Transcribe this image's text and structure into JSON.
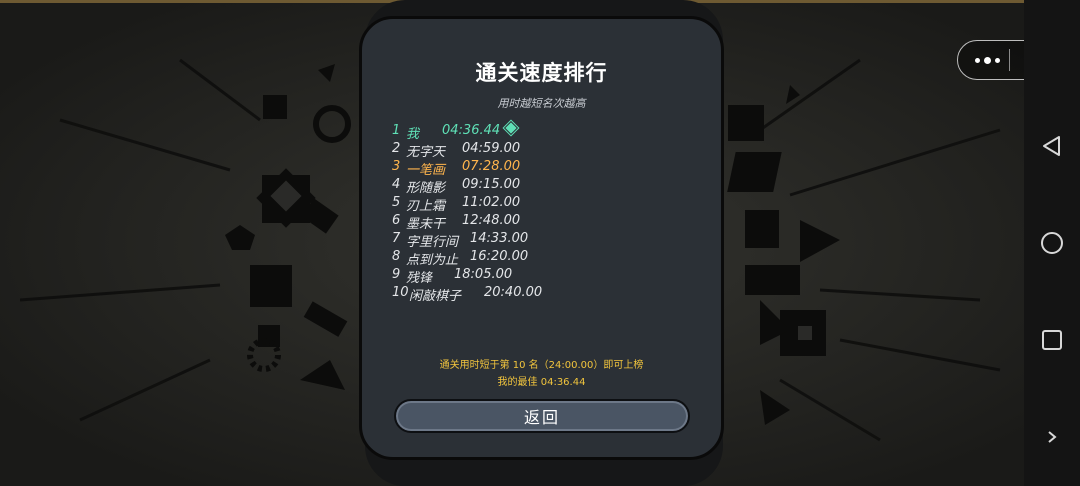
{
  "dialog": {
    "title": "通关速度排行",
    "subtitle": "用时越短名次越高",
    "rankings": [
      {
        "rank": "1",
        "name": "我",
        "time": "04:36.44",
        "highlight": "self"
      },
      {
        "rank": "2",
        "name": "无字天",
        "time": "04:59.00"
      },
      {
        "rank": "3",
        "name": "一笔画",
        "time": "07:28.00",
        "highlight": "gold"
      },
      {
        "rank": "4",
        "name": "形随影",
        "time": "09:15.00"
      },
      {
        "rank": "5",
        "name": "刃上霜",
        "time": "11:02.00"
      },
      {
        "rank": "6",
        "name": "墨未干",
        "time": "12:48.00"
      },
      {
        "rank": "7",
        "name": "字里行间",
        "time": "14:33.00"
      },
      {
        "rank": "8",
        "name": "点到为止",
        "time": "16:20.00"
      },
      {
        "rank": "9",
        "name": "残锋",
        "time": "18:05.00"
      },
      {
        "rank": "10",
        "name": "闲敲棋子",
        "time": "20:40.00"
      }
    ],
    "note": "通关用时短于第 10 名（24:00.00）即可上榜",
    "best": "我的最佳  04:36.44",
    "back_label": "返回"
  },
  "colors": {
    "self": "#5fe0b6",
    "gold": "#ffb54d",
    "note": "#f2c53d",
    "panel": "#2b3036"
  },
  "icons": {
    "capsule_more": "more-dots-icon",
    "capsule_close": "target-close-icon",
    "nav_back": "triangle-back-icon",
    "nav_home": "circle-home-icon",
    "nav_recents": "square-recents-icon",
    "nav_expand": "chevron-right-icon"
  }
}
